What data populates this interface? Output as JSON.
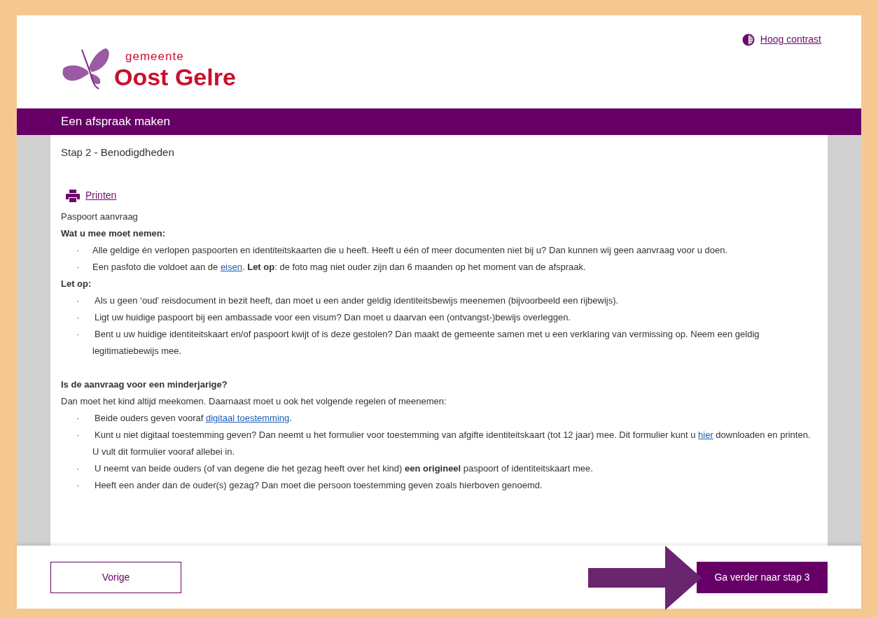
{
  "header": {
    "logo": {
      "small": "gemeente",
      "large": "Oost Gelre"
    },
    "contrast_link": "Hoog contrast"
  },
  "title_bar": "Een afspraak maken",
  "step_title": "Stap 2 - Benodigdheden",
  "print_link": "Printen",
  "blocks": [
    {
      "kind": "paragraph",
      "parts": [
        {
          "kind": "text",
          "text": "Paspoort aanvraag"
        }
      ]
    },
    {
      "kind": "heading",
      "parts": [
        {
          "kind": "text",
          "text": "Wat u mee moet nemen:"
        }
      ]
    },
    {
      "kind": "bullet",
      "marker": "·",
      "parts": [
        {
          "kind": "text",
          "text": "Alle geldige én verlopen paspoorten en identiteitskaarten die u heeft. Heeft u één of meer documenten niet bij u? Dan kunnen wij geen aanvraag voor u doen."
        }
      ]
    },
    {
      "kind": "bullet",
      "marker": "·",
      "parts": [
        {
          "kind": "text",
          "text": "Een pasfoto die voldoet aan de "
        },
        {
          "kind": "link",
          "text": "eisen"
        },
        {
          "kind": "text",
          "text": ". **Let op**: de foto mag niet ouder zijn dan 6 maanden op het moment van de afspraak."
        }
      ]
    },
    {
      "kind": "heading",
      "parts": [
        {
          "kind": "text",
          "text": "Let op:"
        }
      ]
    },
    {
      "kind": "wide_bullet",
      "marker": "·",
      "parts": [
        {
          "kind": "text",
          "text": "Als u geen ‘oud’ reisdocument in bezit heeft, dan moet u een ander geldig identiteitsbewijs meenemen (bijvoorbeeld een rijbewijs)."
        }
      ]
    },
    {
      "kind": "wide_bullet",
      "marker": "·",
      "parts": [
        {
          "kind": "text",
          "text": "Ligt uw huidige paspoort bij een ambassade voor een visum? Dan moet u daarvan een (ontvangst-)bewijs overleggen."
        }
      ]
    },
    {
      "kind": "wide_bullet",
      "marker": "·",
      "parts": [
        {
          "kind": "text",
          "text": "Bent u uw huidige identiteitskaart en/of paspoort kwijt of is deze gestolen? Dan maakt de gemeente samen met u een verklaring van vermissing op. Neem een geldig legitimatiebewijs mee."
        }
      ]
    },
    {
      "kind": "gap"
    },
    {
      "kind": "heading",
      "parts": [
        {
          "kind": "text",
          "text": "Is de aanvraag voor een minderjarige?"
        }
      ]
    },
    {
      "kind": "paragraph",
      "parts": [
        {
          "kind": "text",
          "text": "Dan moet het kind altijd meekomen. Daarnaast moet u ook het volgende regelen of meenemen:"
        }
      ]
    },
    {
      "kind": "wide_bullet",
      "marker": "·",
      "parts": [
        {
          "kind": "text",
          "text": "Beide ouders geven vooraf "
        },
        {
          "kind": "link",
          "text": "digitaal toestemming"
        },
        {
          "kind": "text",
          "text": "."
        }
      ]
    },
    {
      "kind": "wide_bullet",
      "marker": "·",
      "parts": [
        {
          "kind": "text",
          "text": "Kunt u niet digitaal toestemming geven? Dan neemt u het formulier voor toestemming van afgifte identiteitskaart (tot 12 jaar) mee. Dit formulier kunt u "
        },
        {
          "kind": "link",
          "text": "hier"
        },
        {
          "kind": "text",
          "text": " downloaden en printen. U vult dit formulier vooraf allebei in."
        }
      ]
    },
    {
      "kind": "wide_bullet",
      "marker": "·",
      "parts": [
        {
          "kind": "text",
          "text": "U neemt van beide ouders (of van degene die het gezag heeft over het kind) **een origineel** paspoort of identiteitskaart mee."
        }
      ]
    },
    {
      "kind": "wide_bullet",
      "marker": "·",
      "parts": [
        {
          "kind": "text",
          "text": "Heeft een ander dan de ouder(s) gezag? Dan moet die persoon toestemming geven zoals hierboven genoemd."
        }
      ]
    }
  ],
  "footer": {
    "back_button": "Vorige",
    "next_button": "Ga verder naar stap 3"
  }
}
